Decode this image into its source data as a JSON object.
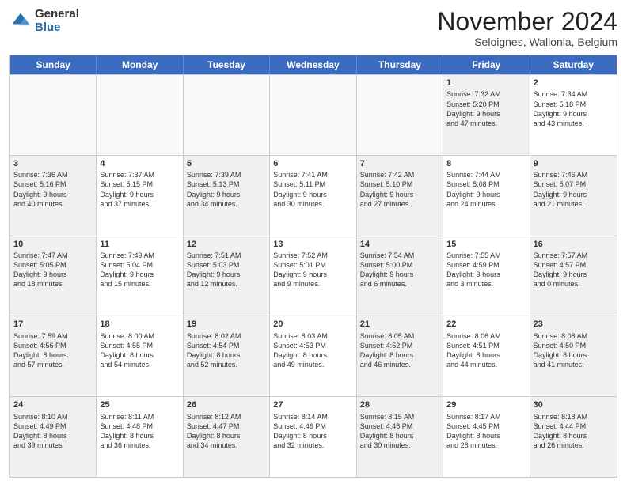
{
  "logo": {
    "general": "General",
    "blue": "Blue"
  },
  "title": "November 2024",
  "subtitle": "Seloignes, Wallonia, Belgium",
  "headers": [
    "Sunday",
    "Monday",
    "Tuesday",
    "Wednesday",
    "Thursday",
    "Friday",
    "Saturday"
  ],
  "weeks": [
    [
      {
        "day": "",
        "info": "",
        "empty": true
      },
      {
        "day": "",
        "info": "",
        "empty": true
      },
      {
        "day": "",
        "info": "",
        "empty": true
      },
      {
        "day": "",
        "info": "",
        "empty": true
      },
      {
        "day": "",
        "info": "",
        "empty": true
      },
      {
        "day": "1",
        "info": "Sunrise: 7:32 AM\nSunset: 5:20 PM\nDaylight: 9 hours\nand 47 minutes.",
        "empty": false,
        "shaded": true
      },
      {
        "day": "2",
        "info": "Sunrise: 7:34 AM\nSunset: 5:18 PM\nDaylight: 9 hours\nand 43 minutes.",
        "empty": false,
        "shaded": false
      }
    ],
    [
      {
        "day": "3",
        "info": "Sunrise: 7:36 AM\nSunset: 5:16 PM\nDaylight: 9 hours\nand 40 minutes.",
        "empty": false,
        "shaded": true
      },
      {
        "day": "4",
        "info": "Sunrise: 7:37 AM\nSunset: 5:15 PM\nDaylight: 9 hours\nand 37 minutes.",
        "empty": false,
        "shaded": false
      },
      {
        "day": "5",
        "info": "Sunrise: 7:39 AM\nSunset: 5:13 PM\nDaylight: 9 hours\nand 34 minutes.",
        "empty": false,
        "shaded": true
      },
      {
        "day": "6",
        "info": "Sunrise: 7:41 AM\nSunset: 5:11 PM\nDaylight: 9 hours\nand 30 minutes.",
        "empty": false,
        "shaded": false
      },
      {
        "day": "7",
        "info": "Sunrise: 7:42 AM\nSunset: 5:10 PM\nDaylight: 9 hours\nand 27 minutes.",
        "empty": false,
        "shaded": true
      },
      {
        "day": "8",
        "info": "Sunrise: 7:44 AM\nSunset: 5:08 PM\nDaylight: 9 hours\nand 24 minutes.",
        "empty": false,
        "shaded": false
      },
      {
        "day": "9",
        "info": "Sunrise: 7:46 AM\nSunset: 5:07 PM\nDaylight: 9 hours\nand 21 minutes.",
        "empty": false,
        "shaded": true
      }
    ],
    [
      {
        "day": "10",
        "info": "Sunrise: 7:47 AM\nSunset: 5:05 PM\nDaylight: 9 hours\nand 18 minutes.",
        "empty": false,
        "shaded": true
      },
      {
        "day": "11",
        "info": "Sunrise: 7:49 AM\nSunset: 5:04 PM\nDaylight: 9 hours\nand 15 minutes.",
        "empty": false,
        "shaded": false
      },
      {
        "day": "12",
        "info": "Sunrise: 7:51 AM\nSunset: 5:03 PM\nDaylight: 9 hours\nand 12 minutes.",
        "empty": false,
        "shaded": true
      },
      {
        "day": "13",
        "info": "Sunrise: 7:52 AM\nSunset: 5:01 PM\nDaylight: 9 hours\nand 9 minutes.",
        "empty": false,
        "shaded": false
      },
      {
        "day": "14",
        "info": "Sunrise: 7:54 AM\nSunset: 5:00 PM\nDaylight: 9 hours\nand 6 minutes.",
        "empty": false,
        "shaded": true
      },
      {
        "day": "15",
        "info": "Sunrise: 7:55 AM\nSunset: 4:59 PM\nDaylight: 9 hours\nand 3 minutes.",
        "empty": false,
        "shaded": false
      },
      {
        "day": "16",
        "info": "Sunrise: 7:57 AM\nSunset: 4:57 PM\nDaylight: 9 hours\nand 0 minutes.",
        "empty": false,
        "shaded": true
      }
    ],
    [
      {
        "day": "17",
        "info": "Sunrise: 7:59 AM\nSunset: 4:56 PM\nDaylight: 8 hours\nand 57 minutes.",
        "empty": false,
        "shaded": true
      },
      {
        "day": "18",
        "info": "Sunrise: 8:00 AM\nSunset: 4:55 PM\nDaylight: 8 hours\nand 54 minutes.",
        "empty": false,
        "shaded": false
      },
      {
        "day": "19",
        "info": "Sunrise: 8:02 AM\nSunset: 4:54 PM\nDaylight: 8 hours\nand 52 minutes.",
        "empty": false,
        "shaded": true
      },
      {
        "day": "20",
        "info": "Sunrise: 8:03 AM\nSunset: 4:53 PM\nDaylight: 8 hours\nand 49 minutes.",
        "empty": false,
        "shaded": false
      },
      {
        "day": "21",
        "info": "Sunrise: 8:05 AM\nSunset: 4:52 PM\nDaylight: 8 hours\nand 46 minutes.",
        "empty": false,
        "shaded": true
      },
      {
        "day": "22",
        "info": "Sunrise: 8:06 AM\nSunset: 4:51 PM\nDaylight: 8 hours\nand 44 minutes.",
        "empty": false,
        "shaded": false
      },
      {
        "day": "23",
        "info": "Sunrise: 8:08 AM\nSunset: 4:50 PM\nDaylight: 8 hours\nand 41 minutes.",
        "empty": false,
        "shaded": true
      }
    ],
    [
      {
        "day": "24",
        "info": "Sunrise: 8:10 AM\nSunset: 4:49 PM\nDaylight: 8 hours\nand 39 minutes.",
        "empty": false,
        "shaded": true
      },
      {
        "day": "25",
        "info": "Sunrise: 8:11 AM\nSunset: 4:48 PM\nDaylight: 8 hours\nand 36 minutes.",
        "empty": false,
        "shaded": false
      },
      {
        "day": "26",
        "info": "Sunrise: 8:12 AM\nSunset: 4:47 PM\nDaylight: 8 hours\nand 34 minutes.",
        "empty": false,
        "shaded": true
      },
      {
        "day": "27",
        "info": "Sunrise: 8:14 AM\nSunset: 4:46 PM\nDaylight: 8 hours\nand 32 minutes.",
        "empty": false,
        "shaded": false
      },
      {
        "day": "28",
        "info": "Sunrise: 8:15 AM\nSunset: 4:46 PM\nDaylight: 8 hours\nand 30 minutes.",
        "empty": false,
        "shaded": true
      },
      {
        "day": "29",
        "info": "Sunrise: 8:17 AM\nSunset: 4:45 PM\nDaylight: 8 hours\nand 28 minutes.",
        "empty": false,
        "shaded": false
      },
      {
        "day": "30",
        "info": "Sunrise: 8:18 AM\nSunset: 4:44 PM\nDaylight: 8 hours\nand 26 minutes.",
        "empty": false,
        "shaded": true
      }
    ]
  ]
}
